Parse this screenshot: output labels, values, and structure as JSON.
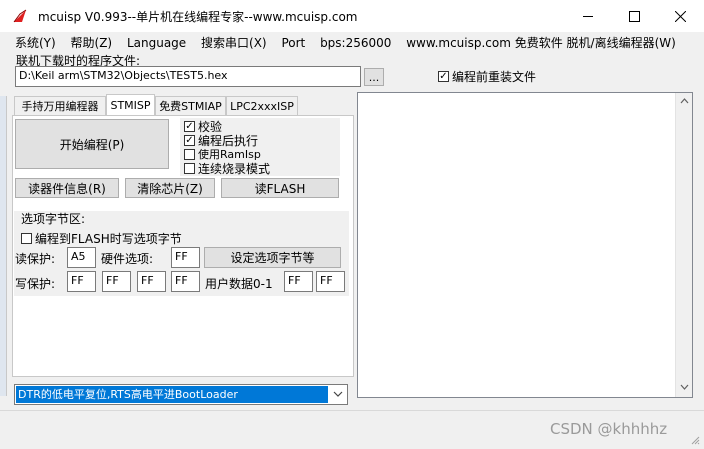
{
  "window": {
    "title": "mcuisp V0.993--单片机在线编程专家--www.mcuisp.com",
    "minimize": "—",
    "maximize": "☐",
    "close": "✕"
  },
  "menu": [
    "系统(Y)",
    "帮助(Z)",
    "Language",
    "搜索串口(X)",
    "Port",
    "bps:256000",
    "www.mcuisp.com 免费软件 脱机/离线编程器(W)"
  ],
  "file": {
    "label": "联机下载时的程序文件:",
    "path": "D:\\Keil arm\\STM32\\Objects\\TEST5.hex",
    "browse": "...",
    "reload_label": "编程前重装文件",
    "reload_checked": true
  },
  "tabs": [
    "手持万用编程器",
    "STMISP",
    "免费STMIAP",
    "LPC2xxxISP"
  ],
  "stmisp": {
    "program_button": "开始编程(P)",
    "options": [
      {
        "label": "校验",
        "checked": true
      },
      {
        "label": "编程后执行",
        "checked": true
      },
      {
        "label": "使用RamIsp",
        "checked": false
      },
      {
        "label": "连续烧录模式",
        "checked": false
      }
    ],
    "read_info": "读器件信息(R)",
    "erase_chip": "清除芯片(Z)",
    "read_flash": "读FLASH",
    "option_bytes": {
      "title": "选项字节区:",
      "write_to_flash_label": "编程到FLASH时写选项字节",
      "write_to_flash_checked": false,
      "read_protect_label": "读保护:",
      "read_protect_value": "A5",
      "hw_option_label": "硬件选项:",
      "hw_option_value": "FF",
      "set_button": "设定选项字节等",
      "write_protect_label": "写保护:",
      "write_protect_values": [
        "FF",
        "FF",
        "FF",
        "FF"
      ],
      "user_data_label": "用户数据0-1",
      "user_data_values": [
        "FF",
        "FF"
      ]
    }
  },
  "boot_select": {
    "value": "DTR的低电平复位,RTS高电平进BootLoader",
    "arrow": "⌄"
  },
  "watermark": "CSDN @khhhhz",
  "colors": {
    "selection": "#0078d7",
    "title_icon": "#e02020"
  }
}
